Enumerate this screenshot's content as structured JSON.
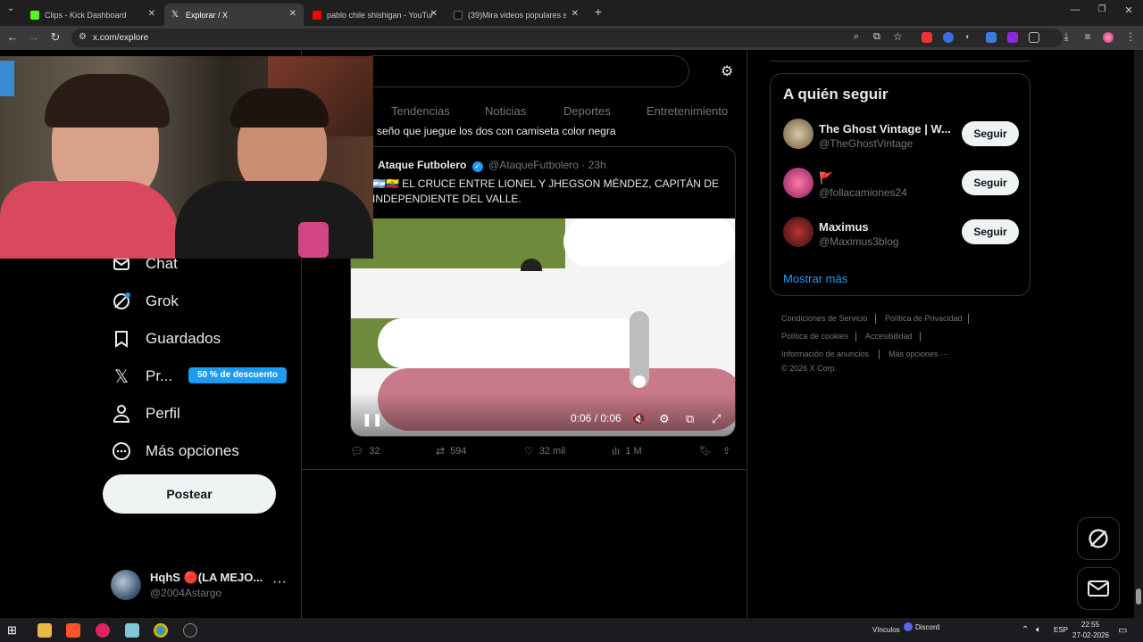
{
  "browser": {
    "tabs": [
      {
        "title": "Clips - Kick Dashboard",
        "favicon_color": "#53fc18"
      },
      {
        "title": "Explorar / X",
        "favicon_color": "#ffffff"
      },
      {
        "title": "pablo chile shishigan - YouTube",
        "favicon_color": "#ff0000"
      },
      {
        "title": "(39)Mira videos populares sele...",
        "favicon_color": "#ffffff"
      }
    ],
    "url": "x.com/explore"
  },
  "sidebar": {
    "items": [
      {
        "label": "Chat",
        "icon": "chat-icon"
      },
      {
        "label": "Grok",
        "icon": "grok-icon"
      },
      {
        "label": "Guardados",
        "icon": "bookmark-icon"
      },
      {
        "label": "Pr...",
        "icon": "x-logo-icon"
      },
      {
        "label": "Perfil",
        "icon": "person-icon"
      },
      {
        "label": "Más opciones",
        "icon": "more-circle-icon"
      }
    ],
    "premium_badge": "50 % de descuento",
    "post_button": "Postear",
    "account": {
      "name": "HqhS 🔴(LA MEJO...",
      "handle": "@2004Astargo",
      "more": "···"
    }
  },
  "explore": {
    "tabs": [
      "Tendencias",
      "Noticias",
      "Deportes",
      "Entretenimiento"
    ],
    "reply_snippet": "seño que juegue los dos con camiseta color negra",
    "quote": {
      "author": "Ataque Futbolero",
      "handle": "@AtaqueFutbolero",
      "time": "· 23h",
      "text": "🇦🇷🇪🇨 EL CRUCE ENTRE LIONEL Y JHEGSON MÉNDEZ, CAPITÁN DE INDEPENDIENTE DEL VALLE.",
      "video_time": "0:06 / 0:06",
      "volume_level": 0.0
    },
    "actions": {
      "replies": "32",
      "reposts": "594",
      "likes": "32 mil",
      "views": "1 M"
    }
  },
  "who_to_follow": {
    "title": "A quién seguir",
    "accounts": [
      {
        "name": "The Ghost Vintage | W...",
        "handle": "@TheGhostVintage",
        "button": "Seguir"
      },
      {
        "name": "🚩",
        "handle": "@follacamiones24",
        "button": "Seguir"
      },
      {
        "name": "Maximus",
        "handle": "@Maximus3blog",
        "button": "Seguir"
      }
    ],
    "show_more": "Mostrar más"
  },
  "footer": {
    "links": [
      "Condiciones de Servicio",
      "Política de Privacidad",
      "Política de cookies",
      "Accesibilidad",
      "Información de anuncios",
      "Más opciones ···"
    ],
    "copyright": "© 2026 X Corp."
  },
  "taskbar": {
    "links_label": "Vínculos",
    "discord_label": "Discord",
    "language": "ESP",
    "time": "22:55",
    "date": "27-02-2026"
  }
}
